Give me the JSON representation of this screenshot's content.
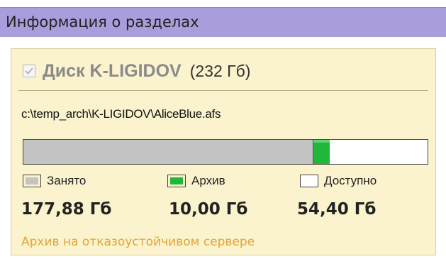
{
  "window": {
    "title": "Информация о разделах"
  },
  "disk": {
    "checked": true,
    "name": "Диск K-LIGIDOV",
    "size": "(232 Гб)",
    "path": "c:\\temp_arch\\K-LIGIDOV\\AliceBlue.afs"
  },
  "usage": {
    "occupied_fraction": 0.7183,
    "archive_fraction": 0.0404,
    "available_fraction": 0.2413
  },
  "legend": {
    "occupied_label": "Занято",
    "archive_label": "Архив",
    "available_label": "Доступно"
  },
  "values": {
    "occupied": "177,88 Гб",
    "archive": "10,00 Гб",
    "available": "54,40 Гб"
  },
  "status": {
    "text": "Архив на отказоустойчивом сервере"
  },
  "colors": {
    "occupied": "#c3c3c3",
    "archive": "#1fb83a",
    "available": "#ffffff",
    "status": "#e0a53b",
    "panel": "#fbf3cd",
    "titlebar": "#a99ddb"
  }
}
